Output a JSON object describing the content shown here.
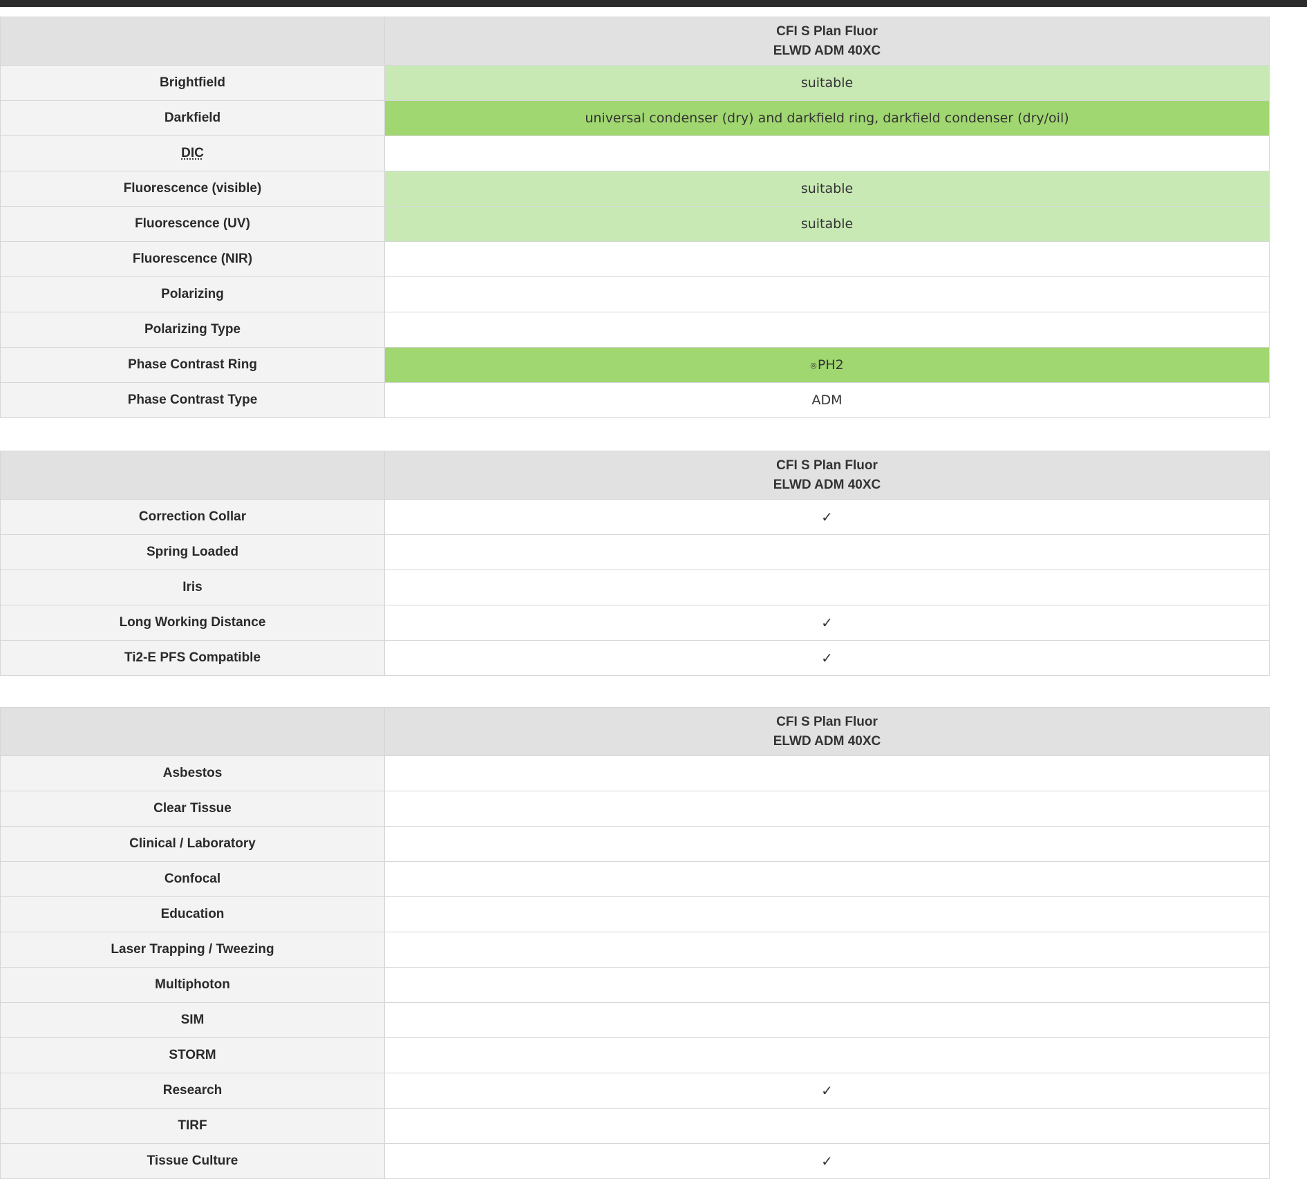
{
  "objective_name_line1": "CFI S Plan Fluor",
  "objective_name_line2": "ELWD ADM 40XC",
  "check_glyph": "✓",
  "colors": {
    "suitable": "#c8e9b4",
    "strong": "#a0d770",
    "header_bg": "#e1e1e1",
    "label_bg": "#f3f3f3"
  },
  "modes": {
    "rows": [
      {
        "label": "Brightfield",
        "value": "suitable",
        "style": "suitable"
      },
      {
        "label": "Darkfield",
        "value": "universal condenser (dry) and darkfield ring, darkfield condenser (dry/oil)",
        "style": "strong"
      },
      {
        "label": "DIC",
        "value": "",
        "style": "none"
      },
      {
        "label": "Fluorescence (visible)",
        "value": "suitable",
        "style": "suitable"
      },
      {
        "label": "Fluorescence (UV)",
        "value": "suitable",
        "style": "suitable"
      },
      {
        "label": "Fluorescence (NIR)",
        "value": "",
        "style": "none"
      },
      {
        "label": "Polarizing",
        "value": "",
        "style": "none"
      },
      {
        "label": "Polarizing Type",
        "value": "",
        "style": "none"
      },
      {
        "label": "Phase Contrast Ring",
        "value": "PH2",
        "ring_icon": "◎",
        "style": "strong"
      },
      {
        "label": "Phase Contrast Type",
        "value": "ADM",
        "style": "none"
      }
    ]
  },
  "features": {
    "rows": [
      {
        "label": "Correction Collar",
        "checked": true
      },
      {
        "label": "Spring Loaded",
        "checked": false
      },
      {
        "label": "Iris",
        "checked": false
      },
      {
        "label": "Long Working Distance",
        "checked": true
      },
      {
        "label": "Ti2-E PFS Compatible",
        "checked": true
      }
    ]
  },
  "applications": {
    "rows": [
      {
        "label": "Asbestos",
        "checked": false
      },
      {
        "label": "Clear Tissue",
        "checked": false
      },
      {
        "label": "Clinical / Laboratory",
        "checked": false
      },
      {
        "label": "Confocal",
        "checked": false
      },
      {
        "label": "Education",
        "checked": false
      },
      {
        "label": "Laser Trapping / Tweezing",
        "checked": false
      },
      {
        "label": "Multiphoton",
        "checked": false
      },
      {
        "label": "SIM",
        "checked": false
      },
      {
        "label": "STORM",
        "checked": false
      },
      {
        "label": "Research",
        "checked": true
      },
      {
        "label": "TIRF",
        "checked": false
      },
      {
        "label": "Tissue Culture",
        "checked": true
      }
    ]
  }
}
